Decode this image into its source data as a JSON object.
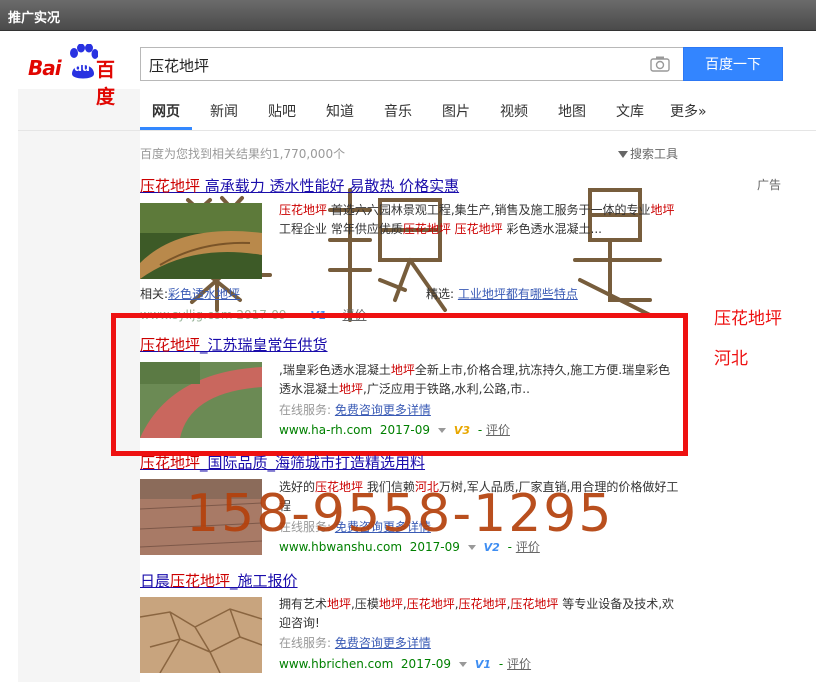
{
  "window": {
    "title": "推广实况"
  },
  "brand": {
    "bai": "Bai",
    "du": "du",
    "cn": "百度"
  },
  "search": {
    "query": "压花地坪",
    "button": "百度一下"
  },
  "tabs": [
    {
      "label": "网页"
    },
    {
      "label": "新闻"
    },
    {
      "label": "贴吧"
    },
    {
      "label": "知道"
    },
    {
      "label": "音乐"
    },
    {
      "label": "图片"
    },
    {
      "label": "视频"
    },
    {
      "label": "地图"
    },
    {
      "label": "文库"
    },
    {
      "label": "更多»"
    }
  ],
  "result_count": "百度为您找到相关结果约1,770,000个",
  "tools_label": "搜索工具",
  "ad_tag": "广告",
  "results": [
    {
      "title_em": "压花地坪",
      "title_rest": " 高承载力 透水性能好 易散热 价格实惠",
      "desc": [
        {
          "t": "压花地坪",
          "em": true
        },
        {
          "t": " 首选六六园林景观工程,集生产,销售及施工服务于一体的专业",
          "em": false
        },
        {
          "t": "地坪",
          "em": true
        },
        {
          "t": "工程企业 常年供应优质",
          "em": false
        },
        {
          "t": "压花地坪",
          "em": true
        },
        {
          "t": " ",
          "em": false
        },
        {
          "t": "压花地坪",
          "em": true
        },
        {
          "t": " 彩色透水混凝土...",
          "em": false
        }
      ],
      "related_label": "相关:",
      "related_link": "彩色透水地坪",
      "featured_label": "精选:",
      "featured_link": "工业地坪都有哪些特点",
      "url_line": "www.sylljg.com 2017-09",
      "v_badge": "V1",
      "eval": "评价"
    },
    {
      "title_em": "压花地坪",
      "title_rest": "_江苏瑞皇常年供货",
      "desc": [
        {
          "t": ",瑞皇彩色透水混凝土",
          "em": false
        },
        {
          "t": "地坪",
          "em": true
        },
        {
          "t": "全新上市,价格合理,抗冻持久,施工方便.瑞皇彩色透水混凝土",
          "em": false
        },
        {
          "t": "地坪",
          "em": true
        },
        {
          "t": ",广泛应用于铁路,水利,公路,市..",
          "em": false
        }
      ],
      "service_label": "在线服务:",
      "service_link": "免费咨询更多详情",
      "url": "www.ha-rh.com",
      "date": "2017-09",
      "v_badge": "V3",
      "eval": "评价"
    },
    {
      "title_em": "压花地坪",
      "title_rest": "_国际品质_海筛城市打造精选用料",
      "desc": [
        {
          "t": "选好的",
          "em": false
        },
        {
          "t": "压花地坪",
          "em": true
        },
        {
          "t": " 我们信赖",
          "em": false
        },
        {
          "t": "河北",
          "em": true
        },
        {
          "t": "万树,军人品质,厂家直销,用合理的价格做好工程",
          "em": false
        }
      ],
      "service_label": "在线服务:",
      "service_link": "免费咨询更多详情",
      "url": "www.hbwanshu.com",
      "date": "2017-09",
      "v_badge": "V2",
      "eval": "评价"
    },
    {
      "title_prefix": "日晨",
      "title_em": "压花地坪",
      "title_rest": "_施工报价",
      "desc": [
        {
          "t": "拥有艺术",
          "em": false
        },
        {
          "t": "地坪",
          "em": true
        },
        {
          "t": ",压模",
          "em": false
        },
        {
          "t": "地坪",
          "em": true
        },
        {
          "t": ",",
          "em": false
        },
        {
          "t": "压花地坪",
          "em": true
        },
        {
          "t": ",",
          "em": false
        },
        {
          "t": "压花地坪",
          "em": true
        },
        {
          "t": ",",
          "em": false
        },
        {
          "t": "压花地坪",
          "em": true
        },
        {
          "t": " 等专业设备及技术,欢迎咨询!",
          "em": false
        }
      ],
      "service_label": "在线服务:",
      "service_link": "免费咨询更多详情",
      "url": "www.hbrichen.com",
      "date": "2017-09",
      "v_badge": "V1",
      "eval": "评价"
    }
  ],
  "annotation": {
    "line1": "压花地坪",
    "line2": "河北",
    "phone": "158-9558-1295"
  },
  "colors": {
    "accent": "#3385ff",
    "highlight": "#ee1111",
    "watermark": "#b4410c"
  }
}
